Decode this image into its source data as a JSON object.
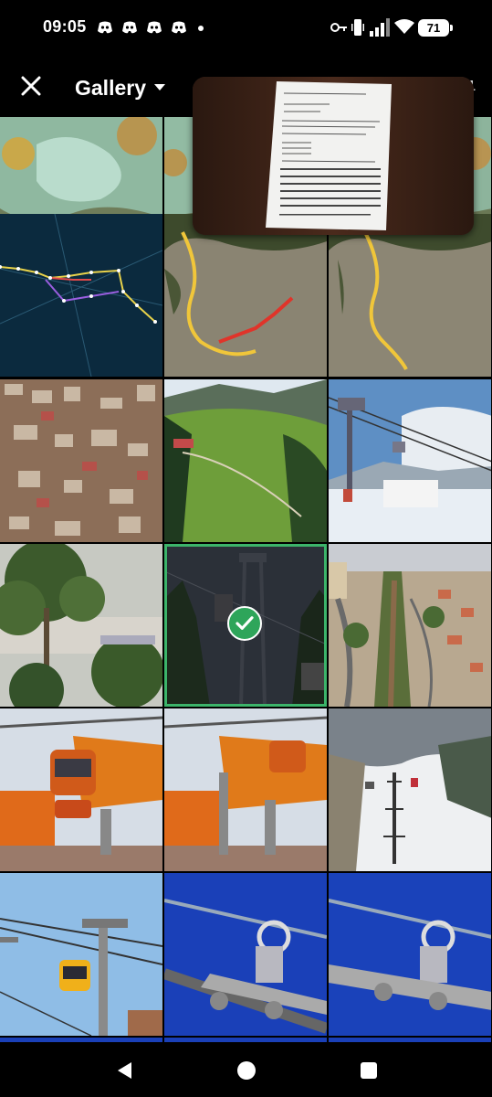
{
  "status_bar": {
    "time": "09:05",
    "notification_icons": [
      "discord-icon",
      "discord-icon",
      "discord-icon",
      "discord-icon"
    ],
    "right_icons": [
      "vpn-key-icon",
      "vibrate-icon",
      "signal-icon",
      "wifi-icon"
    ],
    "battery": "71"
  },
  "top_bar": {
    "title": "Gallery",
    "selected_count": "1"
  },
  "grid": {
    "columns": 3,
    "items": [
      {
        "name": "satellite-map-thumbnail",
        "selected": false
      },
      {
        "name": "satellite-map-thumbnail",
        "selected": false
      },
      {
        "name": "satellite-map-thumbnail",
        "selected": false
      },
      {
        "name": "constellation-thumbnail",
        "selected": false
      },
      {
        "name": "route-map-thumbnail",
        "selected": false
      },
      {
        "name": "route-map-thumbnail",
        "selected": false
      },
      {
        "name": "aerial-city-thumbnail",
        "selected": false
      },
      {
        "name": "green-valley-thumbnail",
        "selected": false
      },
      {
        "name": "snow-cable-car-thumbnail",
        "selected": false
      },
      {
        "name": "trees-city-thumbnail",
        "selected": false
      },
      {
        "name": "night-cable-car-thumbnail",
        "selected": true
      },
      {
        "name": "aerial-railway-town-thumbnail",
        "selected": false
      },
      {
        "name": "orange-gondola-thumbnail",
        "selected": false
      },
      {
        "name": "orange-gondola-thumbnail",
        "selected": false
      },
      {
        "name": "snowy-mountain-lift-thumbnail",
        "selected": false
      },
      {
        "name": "yellow-gondola-thumbnail",
        "selected": false
      },
      {
        "name": "blueprint-pulley-thumbnail",
        "selected": false
      },
      {
        "name": "blueprint-pulley-thumbnail",
        "selected": false
      }
    ]
  },
  "preview": {
    "name": "document-photo-preview"
  },
  "nav_bar": {
    "buttons": [
      "back-icon",
      "home-icon",
      "recents-icon"
    ]
  },
  "colors": {
    "background": "#000000",
    "selection": "#2ea55a"
  }
}
